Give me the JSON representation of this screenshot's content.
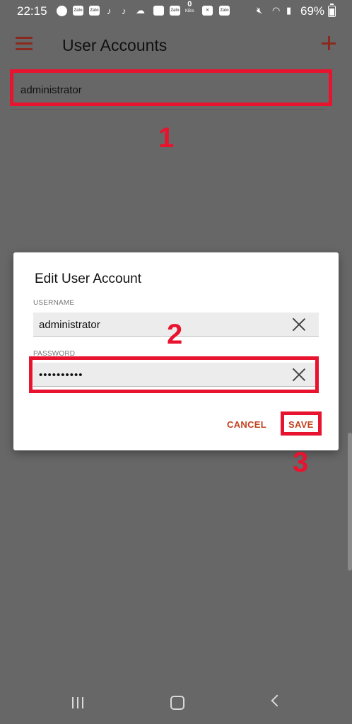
{
  "status_bar": {
    "time": "22:15",
    "battery_percent": "69%",
    "battery_level": 0.69,
    "notification_icons": [
      "messenger-icon",
      "zalo-icon",
      "zalo-icon",
      "tiktok-icon",
      "tiktok-icon",
      "cloud-icon",
      "image-icon",
      "zalo-icon",
      "network-speed-icon",
      "close-box-icon",
      "zalo-icon"
    ],
    "zalo_label": "Zalo",
    "net_speed_value": "0",
    "net_speed_unit": "KB/s"
  },
  "app_bar": {
    "title": "User Accounts"
  },
  "accounts": [
    {
      "name": "administrator"
    }
  ],
  "annotations": {
    "step1": "1",
    "step2": "2",
    "step3": "3"
  },
  "dialog": {
    "title": "Edit User Account",
    "username_label": "USERNAME",
    "username_value": "administrator",
    "password_label": "PASSWORD",
    "password_value": "••••••••••",
    "cancel_label": "CANCEL",
    "save_label": "SAVE"
  },
  "colors": {
    "scrim": "#676767",
    "accent": "#c2411e",
    "highlight": "#e8132f",
    "dialog_bg": "#ffffff"
  }
}
